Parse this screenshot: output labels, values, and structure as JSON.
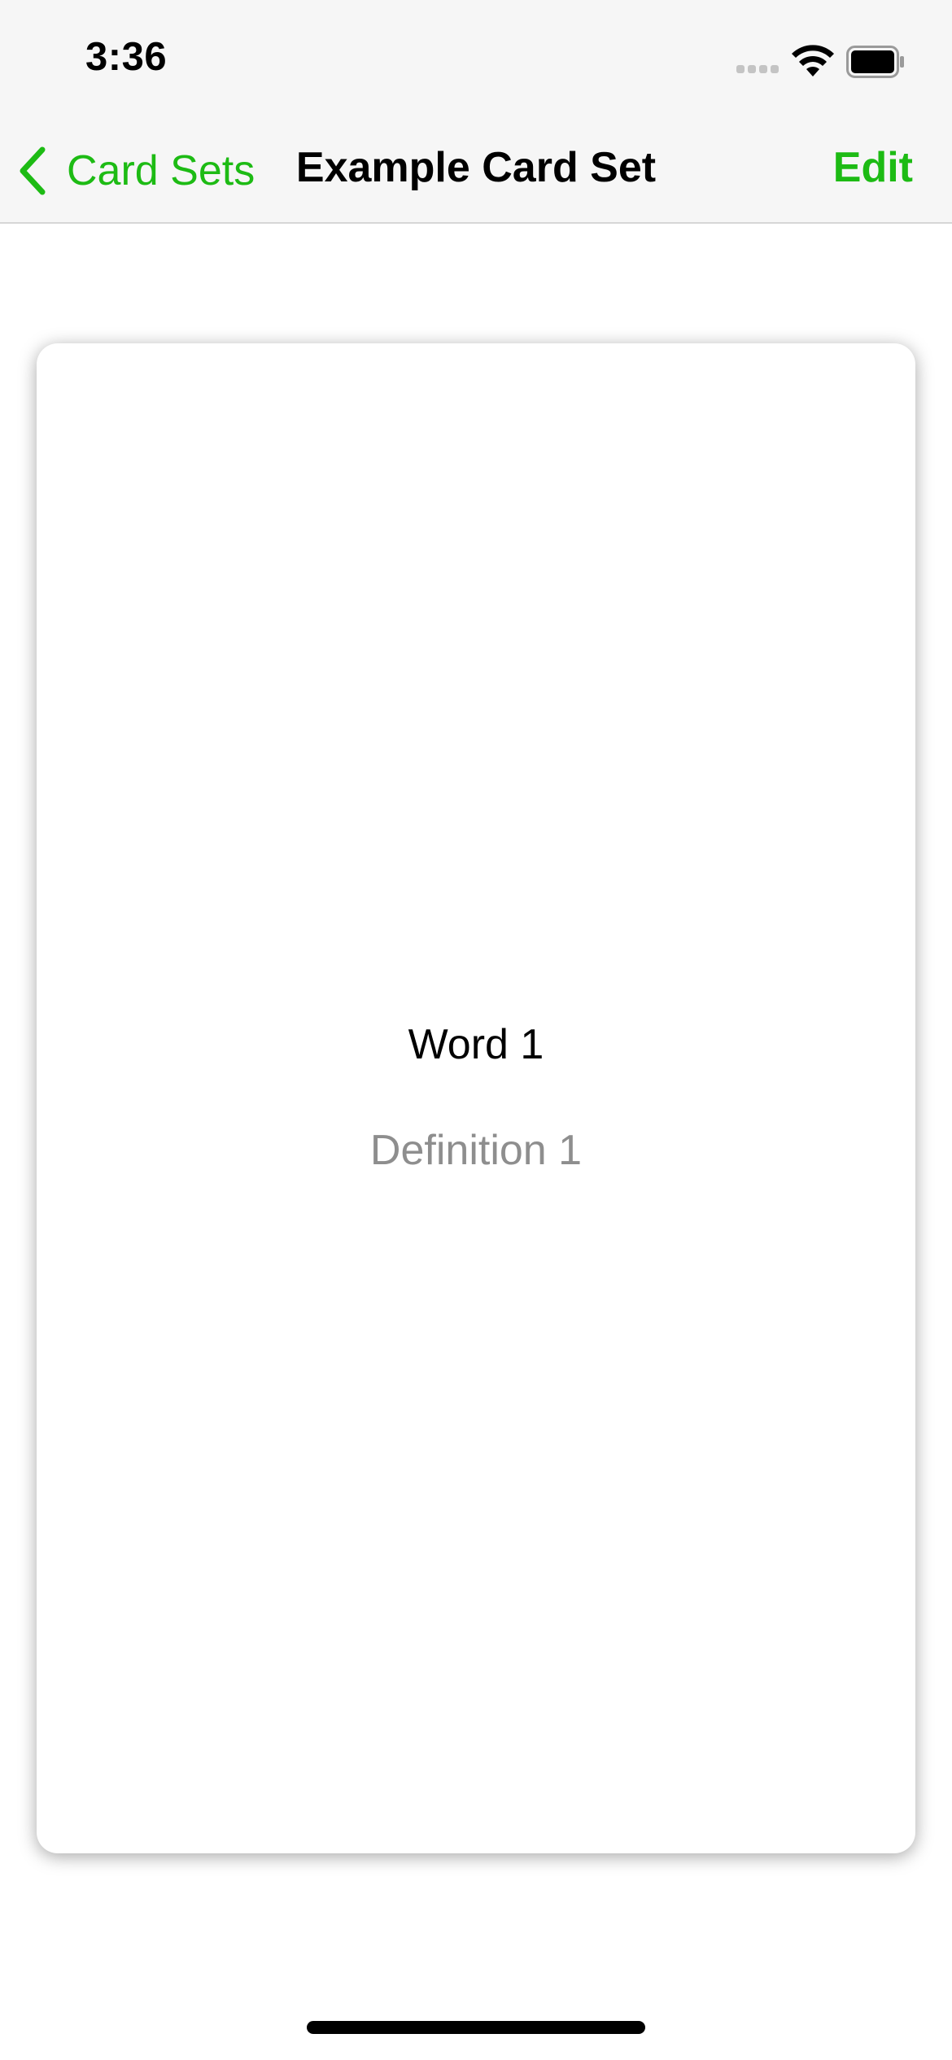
{
  "status_bar": {
    "time": "3:36"
  },
  "nav_bar": {
    "back_label": "Card Sets",
    "title": "Example Card Set",
    "edit_label": "Edit"
  },
  "card": {
    "word": "Word 1",
    "definition": "Definition 1"
  },
  "colors": {
    "accent": "#1dbb14",
    "secondary_text": "#8e8e8e",
    "bar_background": "#f6f6f6"
  },
  "icons": {
    "back": "chevron-left-icon",
    "signal": "cellular-signal-icon",
    "wifi": "wifi-icon",
    "battery": "battery-icon"
  }
}
